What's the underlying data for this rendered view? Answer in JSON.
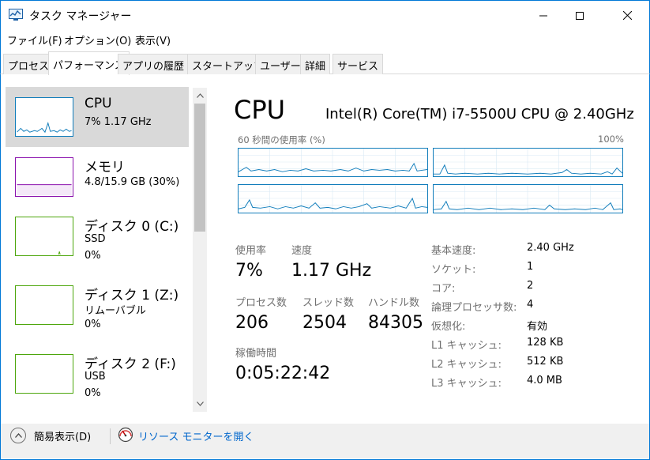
{
  "window": {
    "title": "タスク マネージャー"
  },
  "menu": [
    "ファイル(F)",
    "オプション(O)",
    "表示(V)"
  ],
  "tabs": [
    "プロセス",
    "パフォーマンス",
    "アプリの履歴",
    "スタートアップ",
    "ユーザー",
    "詳細",
    "サービス"
  ],
  "active_tab": "パフォーマンス",
  "sidebar": [
    {
      "title": "CPU",
      "line1": "7% 1.17 GHz",
      "line2": ""
    },
    {
      "title": "メモリ",
      "line1": "4.8/15.9 GB (30%)",
      "line2": ""
    },
    {
      "title": "ディスク 0 (C:)",
      "line1": "SSD",
      "line2": "0%"
    },
    {
      "title": "ディスク 1 (Z:)",
      "line1": "リムーバブル",
      "line2": "0%"
    },
    {
      "title": "ディスク 2 (F:)",
      "line1": "USB",
      "line2": "0%"
    }
  ],
  "main": {
    "title": "CPU",
    "model": "Intel(R) Core(TM) i7-5500U CPU @ 2.40GHz",
    "graph_label_left": "60 秒間の使用率 (%)",
    "graph_label_right": "100%",
    "stats": {
      "usage_label": "使用率",
      "usage_value": "7%",
      "speed_label": "速度",
      "speed_value": "1.17 GHz",
      "processes_label": "プロセス数",
      "processes_value": "206",
      "threads_label": "スレッド数",
      "threads_value": "2504",
      "handles_label": "ハンドル数",
      "handles_value": "84305",
      "uptime_label": "稼働時間",
      "uptime_value": "0:05:22:42"
    },
    "details": [
      {
        "label": "基本速度:",
        "value": "2.40 GHz"
      },
      {
        "label": "ソケット:",
        "value": "1"
      },
      {
        "label": "コア:",
        "value": "2"
      },
      {
        "label": "論理プロセッサ数:",
        "value": "4"
      },
      {
        "label": "仮想化:",
        "value": "有効"
      },
      {
        "label": "L1 キャッシュ:",
        "value": "128 KB"
      },
      {
        "label": "L2 キャッシュ:",
        "value": "512 KB"
      },
      {
        "label": "L3 キャッシュ:",
        "value": "4.0 MB"
      }
    ]
  },
  "bottom": {
    "fewer_details": "簡易表示(D)",
    "resource_monitor": "リソース モニターを開く"
  },
  "colors": {
    "cpu": "#117dbb",
    "memory": "#8b12ae",
    "disk": "#4da60c",
    "window_border": "#0078d7"
  },
  "icons": {
    "app": "task-manager-icon",
    "resmon": "resource-monitor-icon"
  }
}
